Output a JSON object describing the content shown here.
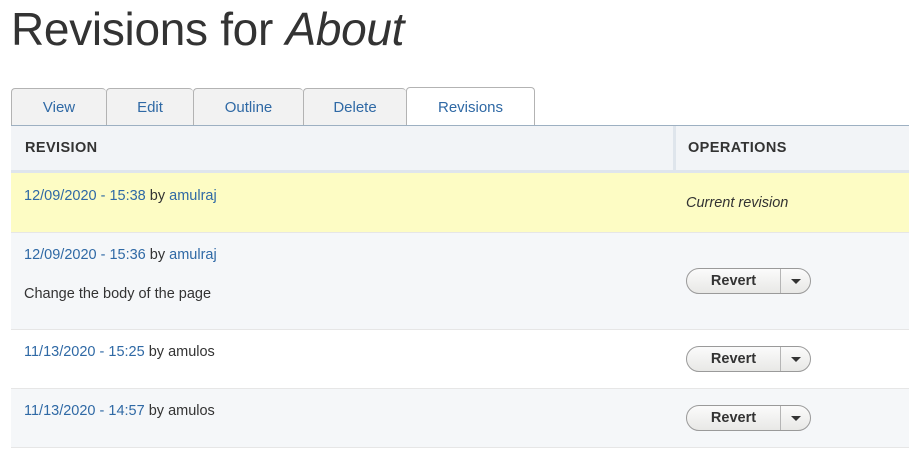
{
  "page": {
    "title_prefix": "Revisions for ",
    "title_node": "About"
  },
  "tabs": [
    {
      "label": "View"
    },
    {
      "label": "Edit"
    },
    {
      "label": "Outline"
    },
    {
      "label": "Delete"
    },
    {
      "label": "Revisions",
      "active": true
    }
  ],
  "table": {
    "headers": {
      "revision": "REVISION",
      "operations": "OPERATIONS"
    },
    "rows": [
      {
        "date": "12/09/2020 - 15:38",
        "by": "by",
        "author": "amulraj",
        "current_label": "Current revision"
      },
      {
        "date": "12/09/2020 - 15:36",
        "by": "by",
        "author": "amulraj",
        "log": "Change the body of the page",
        "action": "Revert"
      },
      {
        "date": "11/13/2020 - 15:25",
        "by": "by",
        "author": "amulos",
        "action": "Revert"
      },
      {
        "date": "11/13/2020 - 14:57",
        "by": "by",
        "author": "amulos",
        "action": "Revert"
      }
    ]
  },
  "icons": {
    "dropdown": "chevron-down-icon"
  },
  "colors": {
    "link": "#2f69a5",
    "current_row": "#fdfcc4",
    "header_bg": "#f2f4f7"
  }
}
